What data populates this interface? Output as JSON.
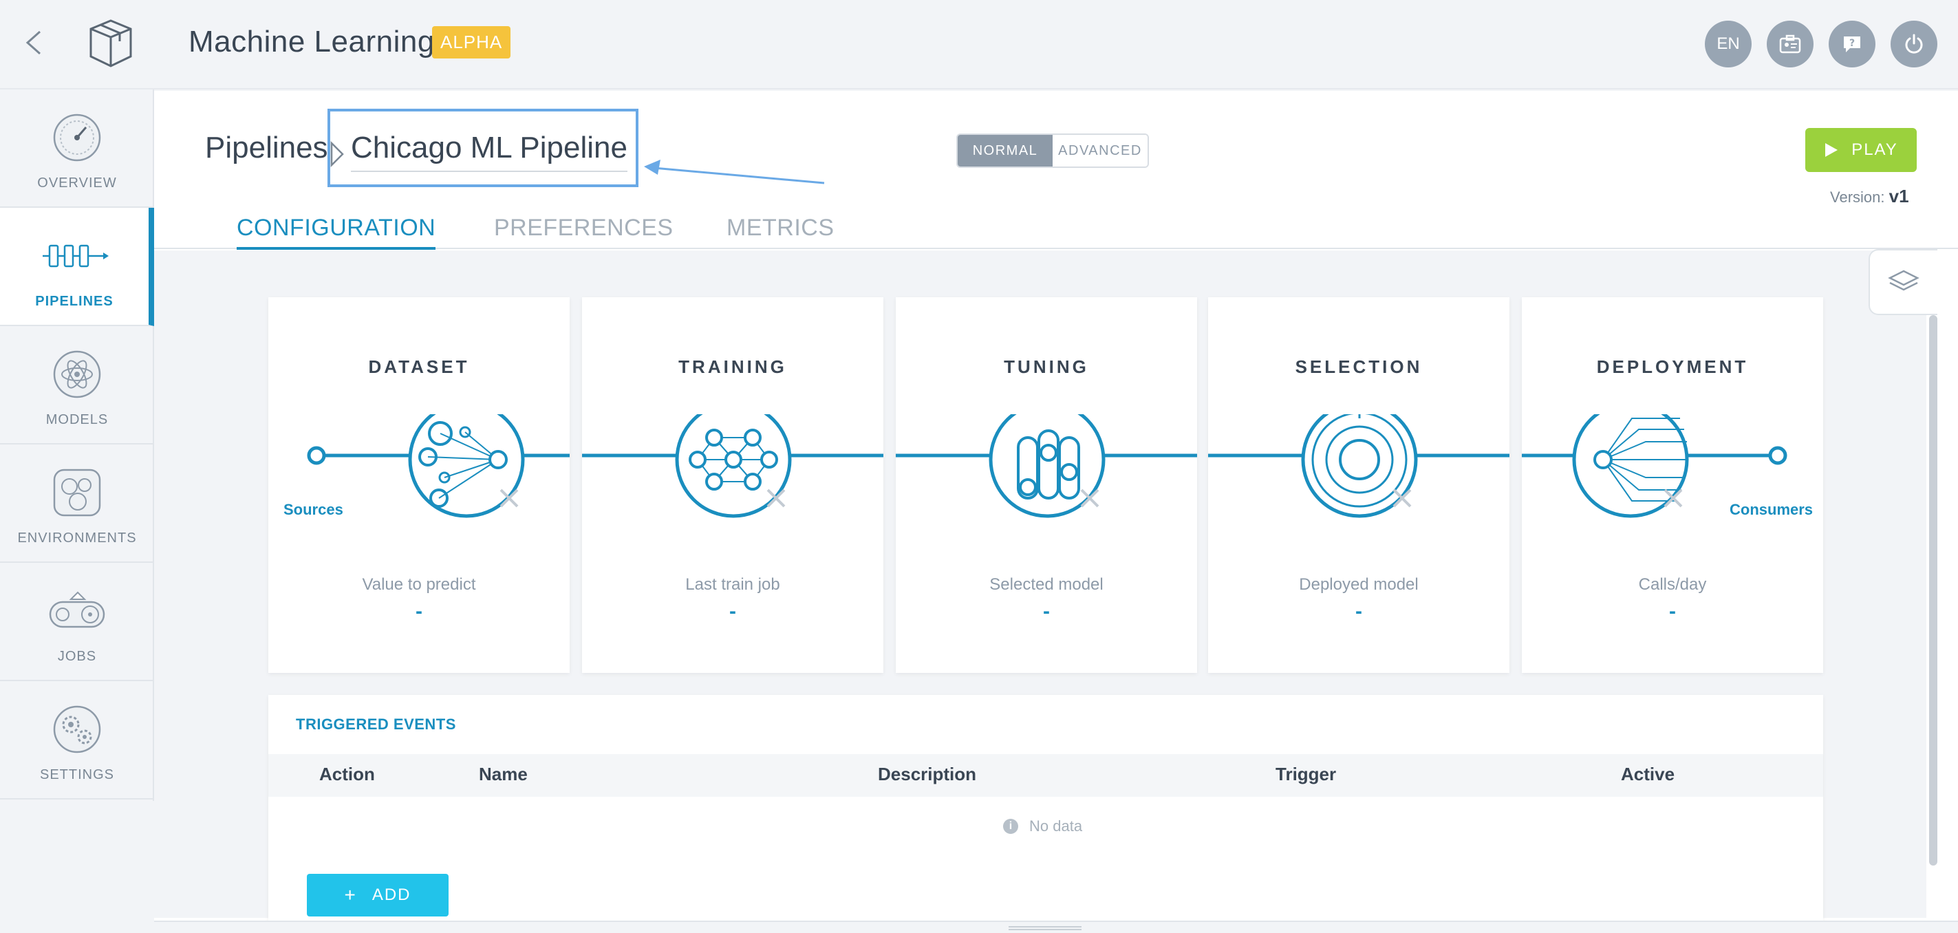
{
  "header": {
    "app_title": "Machine Learning",
    "badge": "ALPHA",
    "lang": "EN"
  },
  "sidebar": {
    "items": [
      {
        "label": "OVERVIEW",
        "icon": "gauge-icon"
      },
      {
        "label": "PIPELINES",
        "icon": "pipeline-icon"
      },
      {
        "label": "MODELS",
        "icon": "atom-icon"
      },
      {
        "label": "ENVIRONMENTS",
        "icon": "environments-icon"
      },
      {
        "label": "JOBS",
        "icon": "conveyor-icon"
      },
      {
        "label": "SETTINGS",
        "icon": "gears-icon"
      }
    ]
  },
  "page": {
    "breadcrumb_root": "Pipelines",
    "pipeline_name": "Chicago ML Pipeline",
    "mode_normal": "NORMAL",
    "mode_advanced": "ADVANCED",
    "play_label": "PLAY",
    "version_label": "Version:",
    "version_value": "v1"
  },
  "tabs": [
    {
      "label": "CONFIGURATION"
    },
    {
      "label": "PREFERENCES"
    },
    {
      "label": "METRICS"
    }
  ],
  "stages": [
    {
      "title": "DATASET",
      "sub": "Value to predict",
      "value": "-"
    },
    {
      "title": "TRAINING",
      "sub": "Last train job",
      "value": "-"
    },
    {
      "title": "TUNING",
      "sub": "Selected model",
      "value": "-"
    },
    {
      "title": "SELECTION",
      "sub": "Deployed model",
      "value": "-"
    },
    {
      "title": "DEPLOYMENT",
      "sub": "Calls/day",
      "value": "-"
    }
  ],
  "flow": {
    "start_label": "Sources",
    "end_label": "Consumers"
  },
  "events": {
    "title": "TRIGGERED EVENTS",
    "columns": [
      "Action",
      "Name",
      "Description",
      "Trigger",
      "Active"
    ],
    "empty_text": "No data",
    "add_label": "ADD"
  },
  "colors": {
    "accent": "#1a8ebf",
    "play": "#9bd13d",
    "alpha_badge": "#f5c33c",
    "add_button": "#22c3ea"
  }
}
